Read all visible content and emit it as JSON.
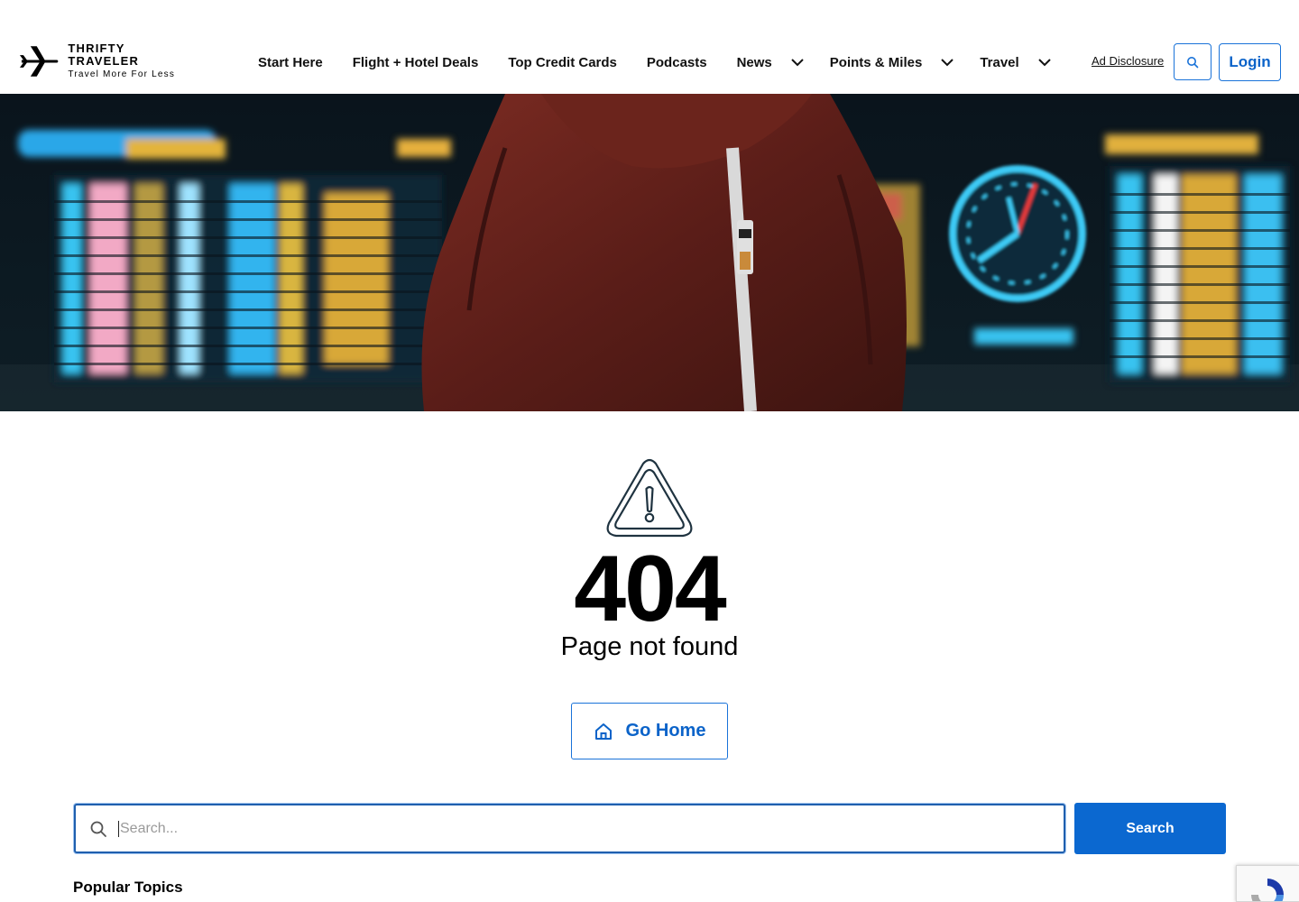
{
  "brand": {
    "name": "THRIFTY TRAVELER",
    "tagline": "Travel More For Less"
  },
  "nav": {
    "items": [
      {
        "label": "Start Here",
        "dropdown": false
      },
      {
        "label": "Flight + Hotel Deals",
        "dropdown": false
      },
      {
        "label": "Top Credit Cards",
        "dropdown": false
      },
      {
        "label": "Podcasts",
        "dropdown": false
      },
      {
        "label": "News",
        "dropdown": true
      },
      {
        "label": "Points & Miles",
        "dropdown": true
      },
      {
        "label": "Travel",
        "dropdown": true
      }
    ],
    "ad_disclosure": "Ad Disclosure",
    "login_label": "Login"
  },
  "error": {
    "code": "404",
    "message": "Page not found",
    "home_label": "Go Home"
  },
  "search": {
    "placeholder": "Search...",
    "value": "",
    "button_label": "Search"
  },
  "popular": {
    "heading": "Popular Topics"
  },
  "colors": {
    "accent": "#0b68d0",
    "accent_border": "#1a73d9",
    "text": "#111111"
  },
  "icons": {
    "logo": "airplane-icon",
    "search": "search-icon",
    "warning": "warning-triangle-icon",
    "home": "home-icon",
    "chevron": "chevron-down-icon"
  }
}
